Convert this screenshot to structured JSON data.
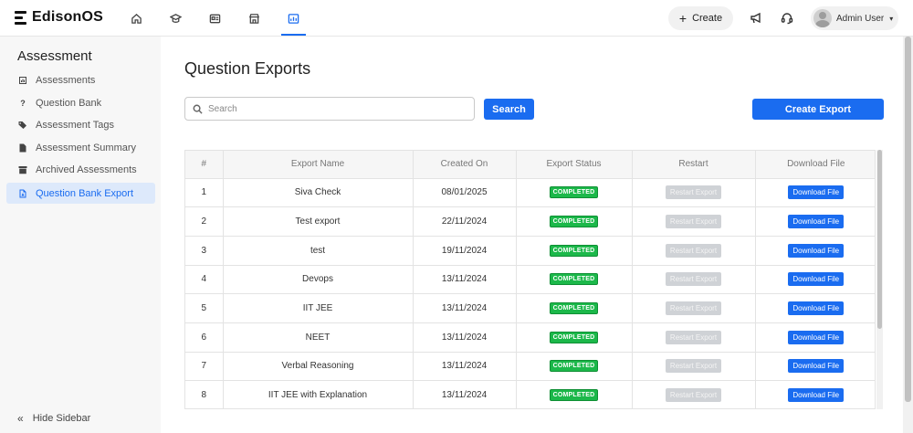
{
  "app": {
    "name": "EdisonOS"
  },
  "topbar": {
    "nav_icons": [
      "home-icon",
      "graduation-cap-icon",
      "id-card-icon",
      "store-icon",
      "assessment-icon"
    ],
    "create_label": "Create",
    "user_name": "Admin User"
  },
  "sidebar": {
    "title": "Assessment",
    "items": [
      {
        "label": "Assessments",
        "icon": "chart-icon"
      },
      {
        "label": "Question Bank",
        "icon": "question-icon"
      },
      {
        "label": "Assessment Tags",
        "icon": "tags-icon"
      },
      {
        "label": "Assessment Summary",
        "icon": "file-icon"
      },
      {
        "label": "Archived Assessments",
        "icon": "archive-icon"
      },
      {
        "label": "Question Bank Export",
        "icon": "pdf-file-icon",
        "active": true
      }
    ],
    "hide_label": "Hide Sidebar"
  },
  "main": {
    "title": "Question Exports",
    "search_placeholder": "Search",
    "search_button": "Search",
    "create_export_button": "Create Export"
  },
  "table": {
    "headers": [
      "#",
      "Export Name",
      "Created On",
      "Export Status",
      "Restart",
      "Download File"
    ],
    "rows": [
      {
        "num": "1",
        "name": "Siva Check",
        "date": "08/01/2025",
        "status": "COMPLETED",
        "restart": "Restart Export",
        "download": "Download File"
      },
      {
        "num": "2",
        "name": "Test export",
        "date": "22/11/2024",
        "status": "COMPLETED",
        "restart": "Restart Export",
        "download": "Download File"
      },
      {
        "num": "3",
        "name": "test",
        "date": "19/11/2024",
        "status": "COMPLETED",
        "restart": "Restart Export",
        "download": "Download File"
      },
      {
        "num": "4",
        "name": "Devops",
        "date": "13/11/2024",
        "status": "COMPLETED",
        "restart": "Restart Export",
        "download": "Download File"
      },
      {
        "num": "5",
        "name": "IIT JEE",
        "date": "13/11/2024",
        "status": "COMPLETED",
        "restart": "Restart Export",
        "download": "Download File"
      },
      {
        "num": "6",
        "name": "NEET",
        "date": "13/11/2024",
        "status": "COMPLETED",
        "restart": "Restart Export",
        "download": "Download File"
      },
      {
        "num": "7",
        "name": "Verbal Reasoning",
        "date": "13/11/2024",
        "status": "COMPLETED",
        "restart": "Restart Export",
        "download": "Download File"
      },
      {
        "num": "8",
        "name": "IIT JEE with Explanation",
        "date": "13/11/2024",
        "status": "COMPLETED",
        "restart": "Restart Export",
        "download": "Download File"
      }
    ]
  },
  "colors": {
    "accent": "#1a6cf0",
    "success": "#1cb84a",
    "disabled": "#cfd2d6"
  }
}
